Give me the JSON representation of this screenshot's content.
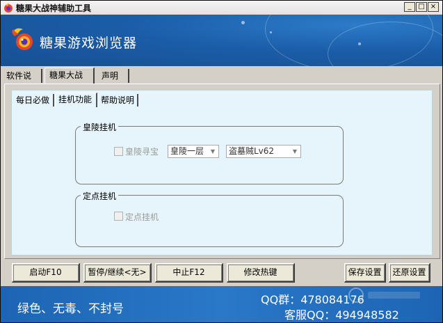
{
  "window": {
    "title": "糖果大战神辅助工具"
  },
  "header": {
    "brand": "糖果游戏浏览器"
  },
  "tabs": [
    {
      "label": "软件说明",
      "active": false
    },
    {
      "label": "糖果大战神",
      "active": true
    },
    {
      "label": "声明",
      "active": false
    }
  ],
  "inner_tabs": [
    {
      "label": "每日必做",
      "active": false
    },
    {
      "label": "挂机功能",
      "active": true
    },
    {
      "label": "帮助说明",
      "active": false
    }
  ],
  "group_huangling": {
    "title": "皇陵挂机",
    "checkbox_label": "皇陵寻宝",
    "floor_select": "皇陵一层",
    "monster_select": "盗墓贼Lv62"
  },
  "group_dingdian": {
    "title": "定点挂机",
    "checkbox_label": "定点挂机"
  },
  "buttons": {
    "start": "启动F10",
    "pause": "暂停/继续<无>",
    "stop": "中止F12",
    "hotkey": "修改热键",
    "save": "保存设置",
    "restore": "还原设置"
  },
  "footer": {
    "slogan": "绿色、无毒、不封号",
    "qq_group": "QQ群：478084176",
    "service_qq": "客服QQ：494948582"
  },
  "colors": {
    "header_blue": "#1b5da8",
    "content_bg": "#e6f4fb",
    "footer_blue": "#2a78c8"
  }
}
